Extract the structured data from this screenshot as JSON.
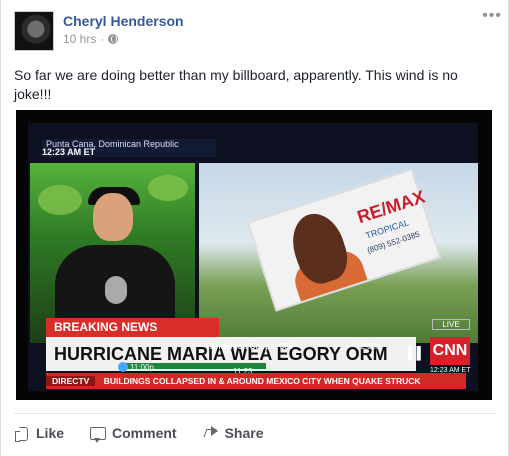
{
  "post": {
    "author": "Cheryl Henderson",
    "meta_time": "10 hrs",
    "meta_dot": "·",
    "more_label": "•••",
    "text": "So far we are doing better than my billboard, apparently. This wind is no joke!!!"
  },
  "tv": {
    "location": "Punta Cana, Dominican Republic",
    "time_top": "12:23 AM ET",
    "breaking": "BREAKING NEWS",
    "headline": "HURRICANE MARIA WEA         EGORY    ORM",
    "anderson": "Anderson Cooper 360",
    "time_1": "11:00p",
    "time_2": "12:00a",
    "time_3": "11:23",
    "live": "LIVE",
    "cnn": "CNN",
    "time_bottom": "12:23 AM ET",
    "ticker_tag": "DIRECTV",
    "ticker_text": "BUILDINGS COLLAPSED IN & AROUND MEXICO CITY WHEN QUAKE STRUCK"
  },
  "billboard": {
    "brand": "RE/MAX",
    "subbrand": "TROPICAL",
    "phone": "(809) 552-0385"
  },
  "actions": {
    "like": "Like",
    "comment": "Comment",
    "share": "Share"
  },
  "colors": {
    "name": "#365899",
    "meta": "#90949c",
    "breaking_red": "#d72e2a",
    "cnn_red": "#d2232a"
  }
}
